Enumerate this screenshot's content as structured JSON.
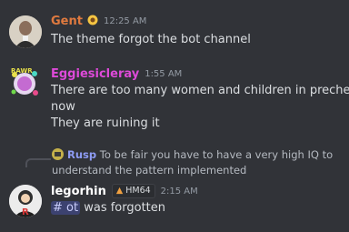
{
  "messages": [
    {
      "author": "Gent",
      "author_color": "#e07a3f",
      "badge_icon": "sunflower-icon",
      "time": "12:25 AM",
      "lines": [
        "The theme forgot the bot channel"
      ]
    },
    {
      "author": "Eggiesicleray",
      "author_color": "#dd4ad8",
      "time": "1:55 AM",
      "lines": [
        "There are too many women and children in precheck",
        "now",
        "They are ruining it"
      ]
    },
    {
      "reply": {
        "author": "Rusp",
        "author_color": "#8e9cf5",
        "text_line1": "To be fair you have to have a very high IQ to",
        "text_line2": "understand the pattern implemented"
      },
      "author": "legorhin",
      "author_color": "#ffffff",
      "tag": "HM64",
      "time": "2:15 AM",
      "mention": "# ot",
      "text": "was forgotten"
    }
  ],
  "accent": "#5865f2"
}
